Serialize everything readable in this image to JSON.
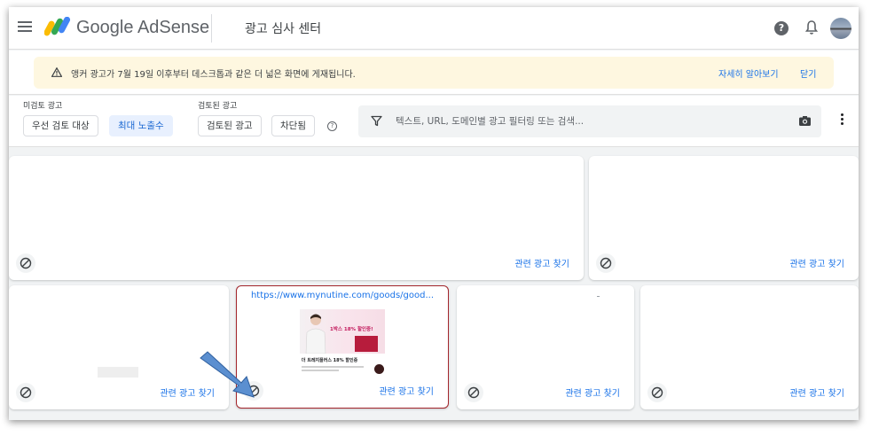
{
  "header": {
    "brand": "Google AdSense",
    "title": "광고 심사 센터",
    "help_glyph": "?"
  },
  "banner": {
    "message": "앵커 광고가 7월 19일 이후부터 데스크톱과 같은 더 넓은 화면에 게재됩니다.",
    "learn_more": "자세히 알아보기",
    "close": "닫기"
  },
  "filters": {
    "unreviewed_label": "미검토 광고",
    "unreviewed_chips": [
      "우선 검토 대상",
      "최대 노출수"
    ],
    "reviewed_label": "검토된 광고",
    "reviewed_chips": [
      "검토된 광고",
      "차단됨"
    ],
    "info_glyph": "?",
    "search_placeholder": "텍스트, URL, 도메인별 광고 필터링 또는 검색..."
  },
  "cards": {
    "related_label": "관련 광고 찾기",
    "highlight_ad": {
      "url": "https://www.mynutine.com/goods/good...",
      "promo": "1박스 18% 할인중!",
      "title": "더 트레지플러스 18% 할인중"
    }
  },
  "colors": {
    "accent": "#1a73e8",
    "banner_bg": "#fef7e0",
    "highlight_border": "#a4262c",
    "annotation_arrow": "#5b8fd0"
  }
}
